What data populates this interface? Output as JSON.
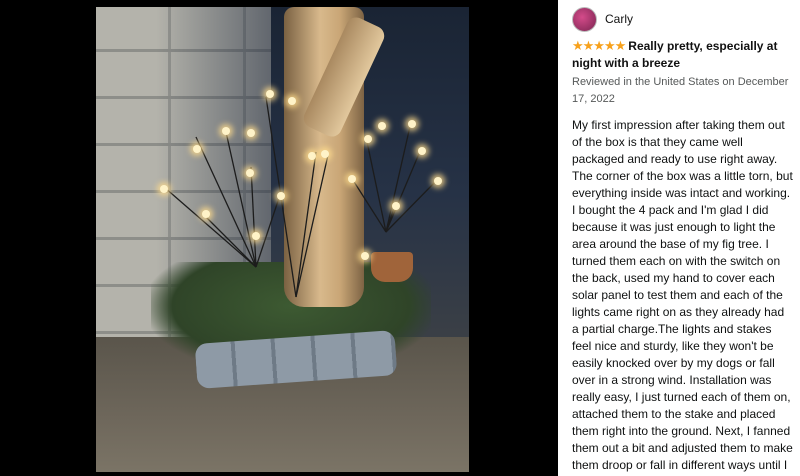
{
  "photo": {
    "alt_icon": "photo-image"
  },
  "review": {
    "reviewer_name": "Carly",
    "rating_stars": "★★★★★",
    "rating_value": 5,
    "headline": "Really pretty, especially at night with a breeze",
    "meta": "Reviewed in the United States on December 17, 2022",
    "body": "My first impression after taking them out of the box is that they came well packaged and ready to use right away. The corner of the box was a little torn, but everything inside was intact and working. I bought the 4 pack and I'm glad I did because it was just enough to light the area around the base of my fig tree. I turned them each on with the switch on the back, used my hand to cover each solar panel to test them and each of the lights came right on as they already had a partial charge.The lights and stakes feel nice and sturdy, like they won't be easily knocked over by my dogs or fall over in a strong wind. Installation was really easy, I just turned each of them on, attached them to the stake and placed them right into the ground. Next, I fanned them out a bit and adjusted them to make them droop or fall in different ways until I was happy.My biggest worry was that these might be unsightly during the daytime, but I find they actually"
  },
  "colors": {
    "star": "#f7a11c",
    "text": "#0f1111",
    "meta": "#565959"
  }
}
